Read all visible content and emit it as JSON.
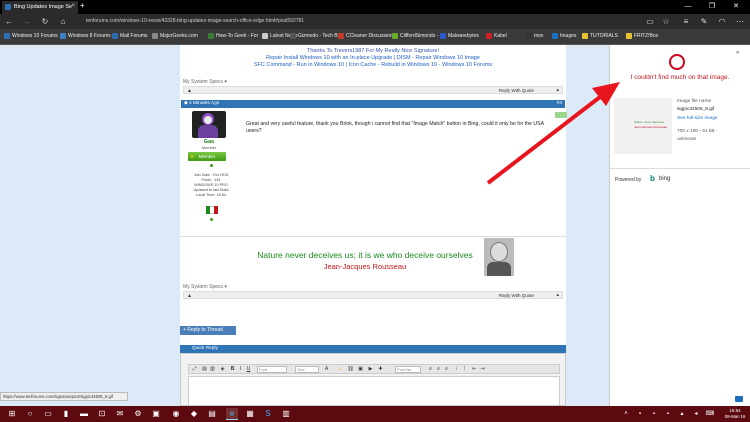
{
  "browser": {
    "tab_title": "Bing Updates Image Se",
    "tab_close": "×",
    "new_tab": "+",
    "url": "tenforums.com/windows-10-news/43328-bing-updates-image-search-office-edge.html#post592781",
    "window_controls": [
      "—",
      "❐",
      "✕"
    ],
    "favorites": [
      {
        "label": "Windows 10 Forums",
        "color": "#2f6fb5"
      },
      {
        "label": "Windows 8 Forums",
        "color": "#3d7fc1"
      },
      {
        "label": "Mail Forums",
        "color": "#2a6aad"
      },
      {
        "label": "MajorGeeks.com",
        "color": "#888888"
      },
      {
        "label": "How-To Geek - For",
        "color": "#3a7a3a"
      },
      {
        "label": "Latest News",
        "color": "#cccccc"
      },
      {
        "label": "Gizmodo - Tech By",
        "color": "#555555"
      },
      {
        "label": "CCleaner Discussion",
        "color": "#c0392b"
      },
      {
        "label": "CliffordSimonds -",
        "color": "#6aaa2a"
      },
      {
        "label": "Malwarebytes",
        "color": "#2a5ac8"
      },
      {
        "label": "Kabel",
        "color": "#cc2222"
      },
      {
        "label": "msn",
        "color": "#333333"
      },
      {
        "label": "Images",
        "color": "#1e6fc2"
      },
      {
        "label": "TUTORIALS",
        "color": "#e8c030"
      },
      {
        "label": "FRITZ!Box",
        "color": "#e8c030"
      }
    ]
  },
  "page": {
    "signature_lines": [
      "Thanks To Trevers1987 For My Really Nice Signature!",
      "Repair Install Windows 10 with an In-place Upgrade | DISM - Repair Windows 10 Image",
      "SFC Command - Run in Windows 10 | Icon Cache - Rebuild in Windows 10 - Windows 10 Forums"
    ],
    "system_specs": "My System Specs",
    "reply_with_quote": "Reply With Quote",
    "post": {
      "time": "4 Minutes Ago",
      "number": "#4",
      "username": "Gas",
      "user_title": "Member",
      "badge": "Member",
      "stats": [
        "Join Date : Oct 2015",
        "Posts : 134",
        "WINDOWS 10 PRO",
        "Updated to last Build",
        "Local Time: 18:54"
      ],
      "text": "Great and very useful feature, thank you Brink, though i cannot find that \"Image Match\" button in Bing, could it only be for the USA users?"
    },
    "quote_line1": "Nature never deceives us; it is we who deceive ourselves",
    "quote_line2": "Jean-Jacques  Rousseau",
    "reply_to_thread": "+ Reply to Thread",
    "quick_reply": "Quick Reply",
    "editor_selects": [
      "Font",
      "Size",
      "Post Ne"
    ],
    "status_url": "https://www.tenforums.com/signaturepics/sigpic34506_8.gif"
  },
  "side_panel": {
    "message": "I couldn't find much on that image.",
    "thumb_line1": "Nature never deceives",
    "thumb_line2": "Jean-Jacques Rousseau",
    "file_name_label": "Image file name",
    "file_name": "sigpic34506_8.gif",
    "full_size_link": "See full-size image",
    "dimensions": "700 x 100 - 51 kB -",
    "unknown": "unknown",
    "powered_by": "Powered by",
    "bing": "bing"
  },
  "taskbar": {
    "time": "18:54",
    "date": "08-Mar-16"
  },
  "colors": {
    "accent_red": "#d0021b",
    "taskbar": "#5c0a0f",
    "forum_blue": "#2f75b5"
  }
}
